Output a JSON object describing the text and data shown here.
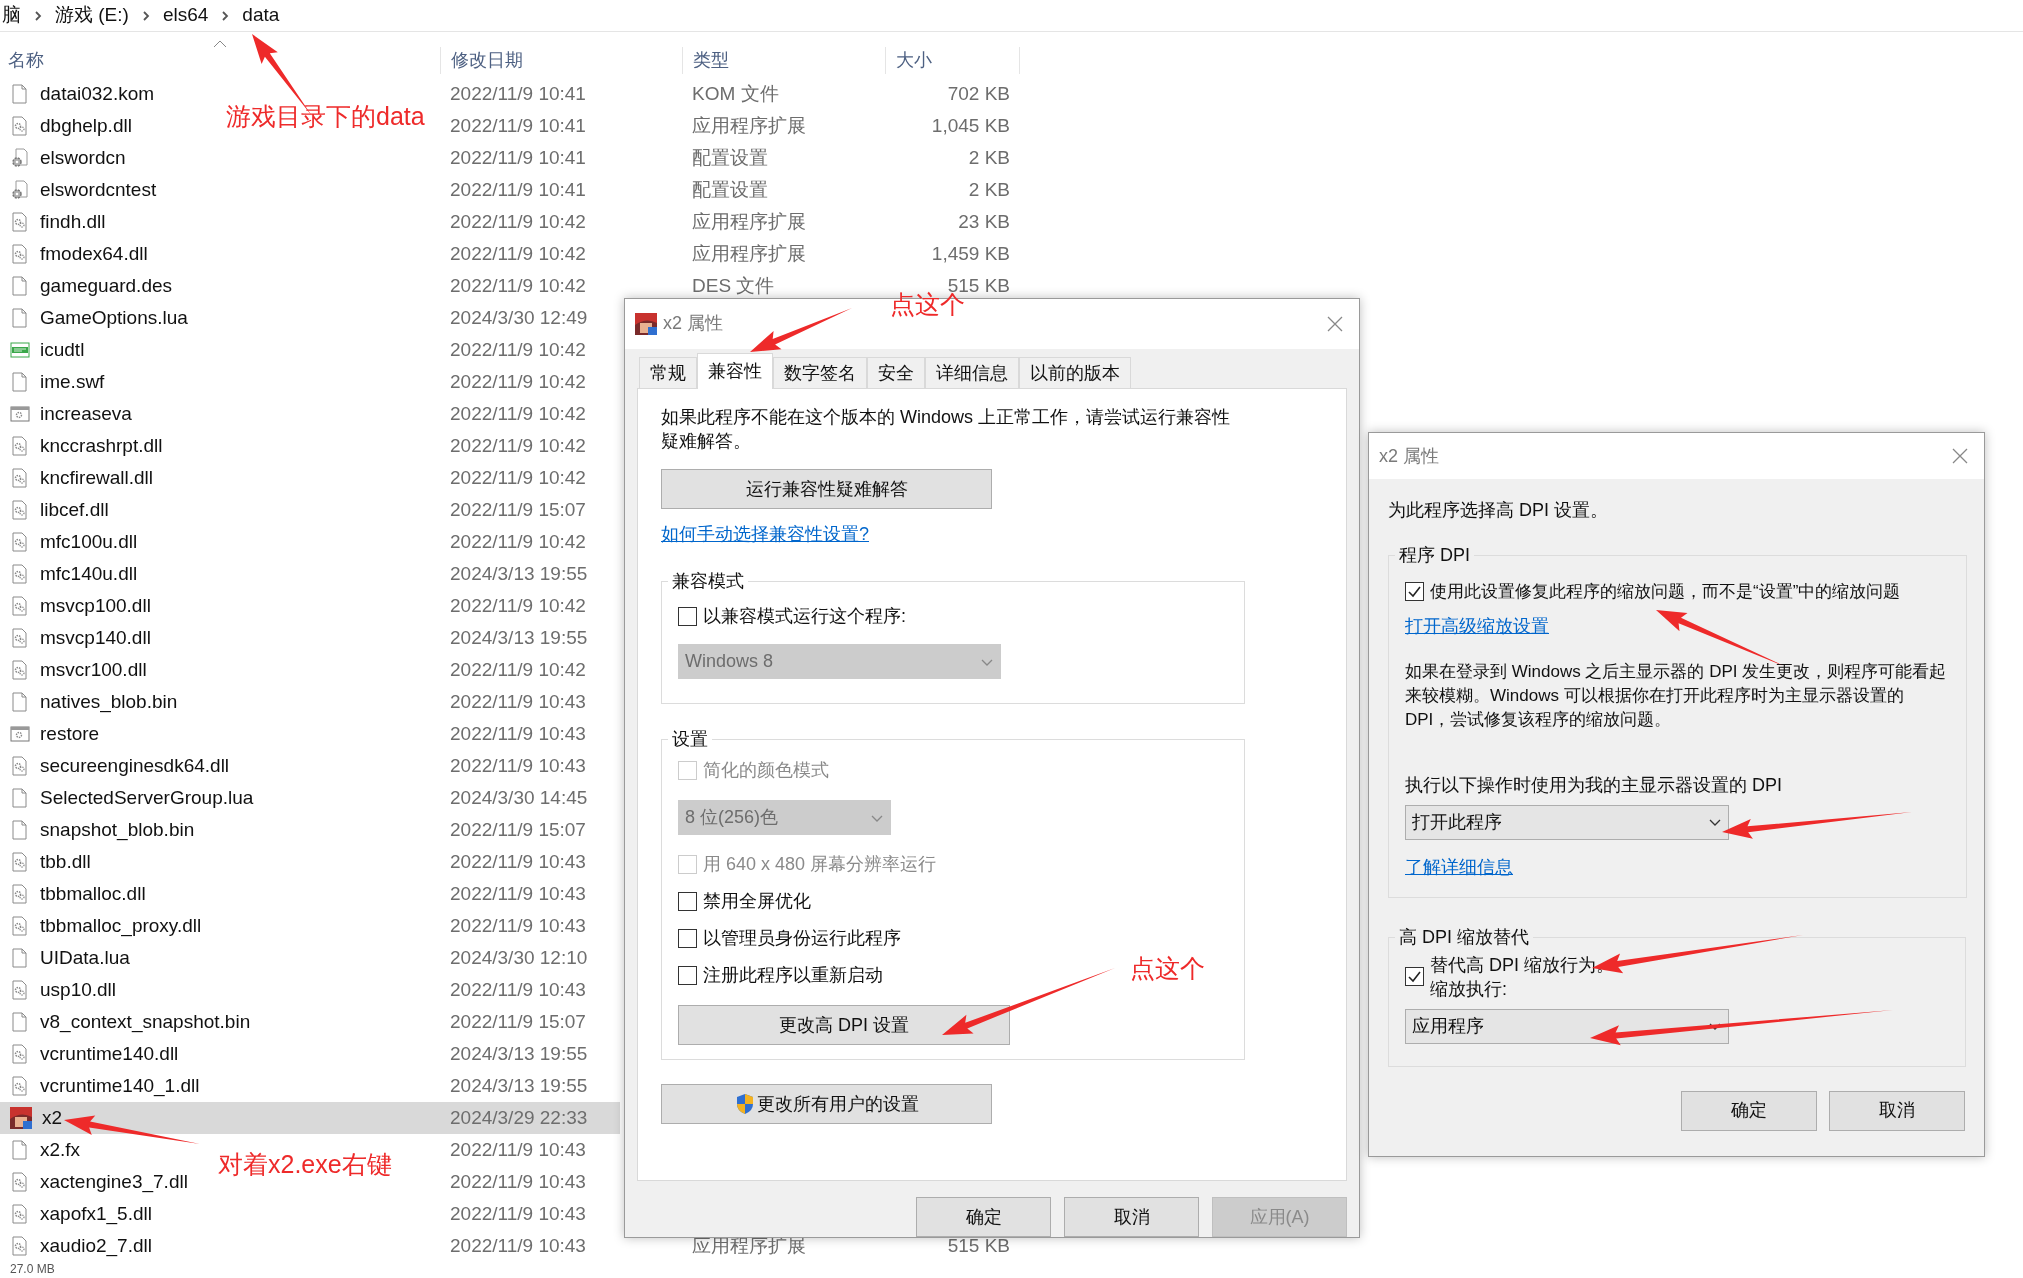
{
  "breadcrumb": [
    "脑",
    "游戏 (E:)",
    "els64",
    "data"
  ],
  "columns": [
    "名称",
    "修改日期",
    "类型",
    "大小"
  ],
  "files": [
    {
      "name": "datai032.kom",
      "date": "2022/11/9 10:41",
      "type": "KOM 文件",
      "size": "702 KB",
      "kind": "blank",
      "selected": false
    },
    {
      "name": "dbghelp.dll",
      "date": "2022/11/9 10:41",
      "type": "应用程序扩展",
      "size": "1,045 KB",
      "kind": "dll",
      "selected": false
    },
    {
      "name": "elswordcn",
      "date": "2022/11/9 10:41",
      "type": "配置设置",
      "size": "2 KB",
      "kind": "config",
      "selected": false
    },
    {
      "name": "elswordcntest",
      "date": "2022/11/9 10:41",
      "type": "配置设置",
      "size": "2 KB",
      "kind": "config",
      "selected": false
    },
    {
      "name": "findh.dll",
      "date": "2022/11/9 10:42",
      "type": "应用程序扩展",
      "size": "23 KB",
      "kind": "dll",
      "selected": false
    },
    {
      "name": "fmodex64.dll",
      "date": "2022/11/9 10:42",
      "type": "应用程序扩展",
      "size": "1,459 KB",
      "kind": "dll",
      "selected": false
    },
    {
      "name": "gameguard.des",
      "date": "2022/11/9 10:42",
      "type": "DES 文件",
      "size": "515 KB",
      "kind": "blank",
      "selected": false
    },
    {
      "name": "GameOptions.lua",
      "date": "2024/3/30 12:49",
      "kind": "blank",
      "selected": false
    },
    {
      "name": "icudtl",
      "date": "2022/11/9 10:42",
      "kind": "vcd",
      "selected": false
    },
    {
      "name": "ime.swf",
      "date": "2022/11/9 10:42",
      "kind": "blank",
      "selected": false
    },
    {
      "name": "increaseva",
      "date": "2022/11/9 10:42",
      "kind": "exe",
      "selected": false
    },
    {
      "name": "knccrashrpt.dll",
      "date": "2022/11/9 10:42",
      "kind": "dll",
      "selected": false
    },
    {
      "name": "kncfirewall.dll",
      "date": "2022/11/9 10:42",
      "kind": "dll",
      "selected": false
    },
    {
      "name": "libcef.dll",
      "date": "2022/11/9 15:07",
      "kind": "dll",
      "selected": false
    },
    {
      "name": "mfc100u.dll",
      "date": "2022/11/9 10:42",
      "kind": "dll",
      "selected": false
    },
    {
      "name": "mfc140u.dll",
      "date": "2024/3/13 19:55",
      "kind": "dll",
      "selected": false
    },
    {
      "name": "msvcp100.dll",
      "date": "2022/11/9 10:42",
      "kind": "dll",
      "selected": false
    },
    {
      "name": "msvcp140.dll",
      "date": "2024/3/13 19:55",
      "kind": "dll",
      "selected": false
    },
    {
      "name": "msvcr100.dll",
      "date": "2022/11/9 10:42",
      "kind": "dll",
      "selected": false
    },
    {
      "name": "natives_blob.bin",
      "date": "2022/11/9 10:43",
      "kind": "blank",
      "selected": false
    },
    {
      "name": "restore",
      "date": "2022/11/9 10:43",
      "kind": "exe",
      "selected": false
    },
    {
      "name": "secureenginesdk64.dll",
      "date": "2022/11/9 10:43",
      "kind": "dll",
      "selected": false
    },
    {
      "name": "SelectedServerGroup.lua",
      "date": "2024/3/30 14:45",
      "kind": "blank",
      "selected": false
    },
    {
      "name": "snapshot_blob.bin",
      "date": "2022/11/9 15:07",
      "kind": "blank",
      "selected": false
    },
    {
      "name": "tbb.dll",
      "date": "2022/11/9 10:43",
      "kind": "dll",
      "selected": false
    },
    {
      "name": "tbbmalloc.dll",
      "date": "2022/11/9 10:43",
      "kind": "dll",
      "selected": false
    },
    {
      "name": "tbbmalloc_proxy.dll",
      "date": "2022/11/9 10:43",
      "kind": "dll",
      "selected": false
    },
    {
      "name": "UIData.lua",
      "date": "2024/3/30 12:10",
      "kind": "blank",
      "selected": false
    },
    {
      "name": "usp10.dll",
      "date": "2022/11/9 10:43",
      "kind": "dll",
      "selected": false
    },
    {
      "name": "v8_context_snapshot.bin",
      "date": "2022/11/9 15:07",
      "kind": "blank",
      "selected": false
    },
    {
      "name": "vcruntime140.dll",
      "date": "2024/3/13 19:55",
      "kind": "dll",
      "selected": false
    },
    {
      "name": "vcruntime140_1.dll",
      "date": "2024/3/13 19:55",
      "kind": "dll",
      "selected": false
    },
    {
      "name": "x2",
      "date": "2024/3/29 22:33",
      "kind": "app",
      "selected": true
    },
    {
      "name": "x2.fx",
      "date": "2022/11/9 10:43",
      "kind": "blank",
      "selected": false
    },
    {
      "name": "xactengine3_7.dll",
      "date": "2022/11/9 10:43",
      "kind": "dll",
      "selected": false
    },
    {
      "name": "xapofx1_5.dll",
      "date": "2022/11/9 10:43",
      "kind": "dll",
      "selected": false
    },
    {
      "name": "xaudio2_7.dll",
      "date": "2022/11/9 10:43",
      "type": "应用程序扩展",
      "size": "515 KB",
      "kind": "dll",
      "selected": false
    }
  ],
  "status_bar": "27.0 MB",
  "compat_dialog": {
    "title": "x2 属性",
    "tabs": [
      {
        "label": "常规",
        "selected": false
      },
      {
        "label": "兼容性",
        "selected": true
      },
      {
        "label": "数字签名",
        "selected": false
      },
      {
        "label": "安全",
        "selected": false
      },
      {
        "label": "详细信息",
        "selected": false
      },
      {
        "label": "以前的版本",
        "selected": false
      }
    ],
    "intro": "如果此程序不能在这个版本的 Windows 上正常工作，请尝试运行兼容性疑难解答。",
    "troubleshoot_button": "运行兼容性疑难解答",
    "help_link": "如何手动选择兼容性设置?",
    "compat_mode": {
      "title": "兼容模式",
      "checkbox": {
        "label": "以兼容模式运行这个程序:",
        "checked": false,
        "disabled": false
      },
      "select": {
        "value": "Windows 8",
        "disabled": true
      }
    },
    "settings": {
      "title": "设置",
      "items": [
        {
          "kind": "checkbox",
          "label": "简化的颜色模式",
          "checked": false,
          "disabled": true
        },
        {
          "kind": "select",
          "value": "8 位(256)色",
          "disabled": true
        },
        {
          "kind": "checkbox",
          "label": "用 640 x 480 屏幕分辨率运行",
          "checked": false,
          "disabled": true
        },
        {
          "kind": "checkbox",
          "label": "禁用全屏优化",
          "checked": false,
          "disabled": false
        },
        {
          "kind": "checkbox",
          "label": "以管理员身份运行此程序",
          "checked": false,
          "disabled": false
        },
        {
          "kind": "checkbox",
          "label": "注册此程序以重新启动",
          "checked": false,
          "disabled": false
        },
        {
          "kind": "button",
          "label": "更改高 DPI 设置"
        }
      ]
    },
    "all_users_button": "更改所有用户的设置",
    "buttons": [
      {
        "label": "确定",
        "disabled": false
      },
      {
        "label": "取消",
        "disabled": false
      },
      {
        "label": "应用(A)",
        "disabled": true
      }
    ]
  },
  "dpi_dialog": {
    "title": "x2 属性",
    "intro": "为此程序选择高 DPI 设置。",
    "program_dpi": {
      "title": "程序 DPI",
      "checkbox": {
        "label": "使用此设置修复此程序的缩放问题，而不是“设置”中的缩放问题",
        "checked": true
      },
      "link": "打开高级缩放设置",
      "description": "如果在登录到 Windows 之后主显示器的 DPI 发生更改，则程序可能看起来较模糊。Windows 可以根据你在打开此程序时为主显示器设置的 DPI，尝试修复该程序的缩放问题。",
      "select_label": "执行以下操作时使用为我的主显示器设置的 DPI",
      "select": "打开此程序",
      "more_link": "了解详细信息"
    },
    "override": {
      "title": "高 DPI 缩放替代",
      "checkbox": {
        "label": "替代高 DPI 缩放行为。",
        "checked": true
      },
      "sub_label": "缩放执行:",
      "select": "应用程序"
    },
    "buttons": [
      "确定",
      "取消"
    ]
  },
  "annotations": [
    {
      "text": "游戏目录下的data"
    },
    {
      "text": "对着x2.exe右键"
    },
    {
      "text": "点这个"
    },
    {
      "text": "点这个"
    }
  ]
}
